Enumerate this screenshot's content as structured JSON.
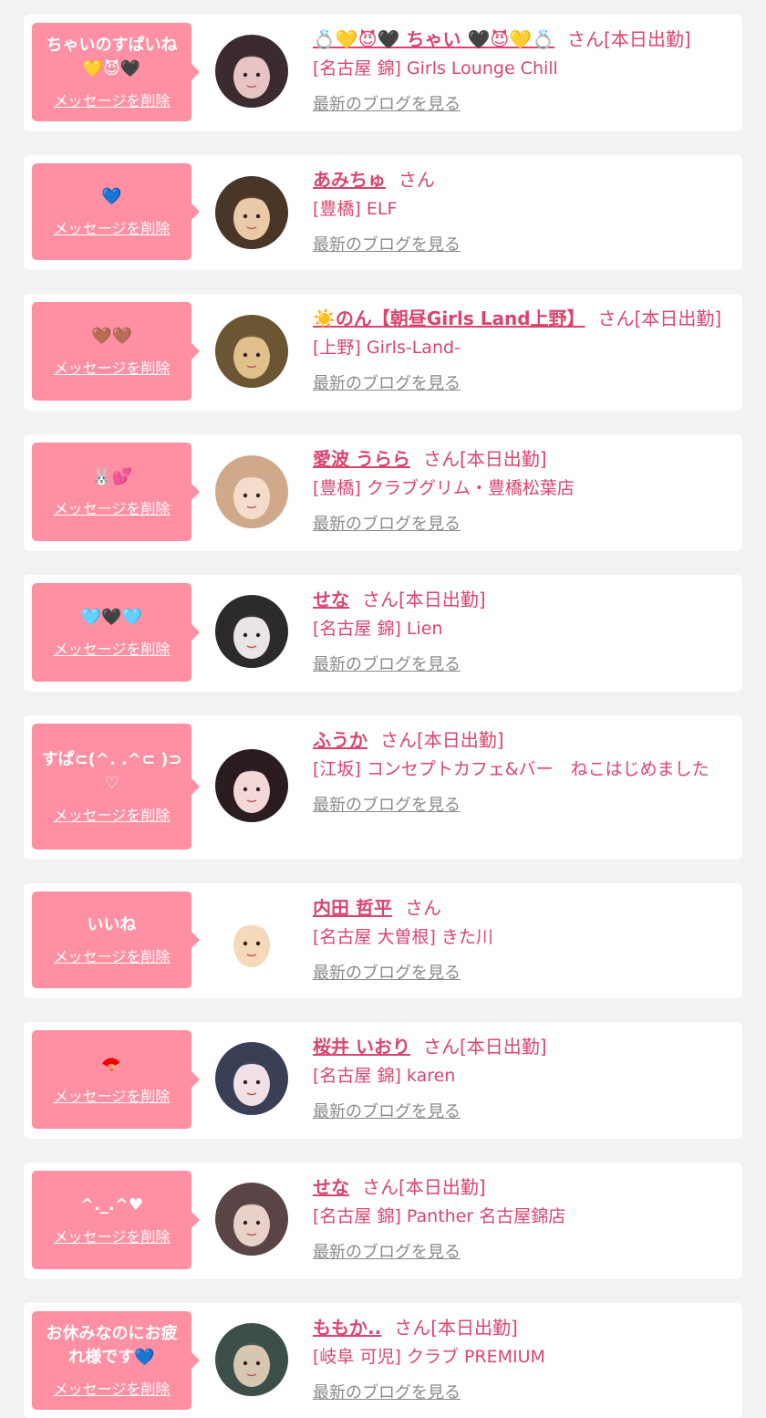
{
  "delete_label": "メッセージを削除",
  "blog_label": "最新のブログを見る",
  "san_label": "さん",
  "colors": {
    "accent": "#d9456e",
    "bubble": "#ff8fa3",
    "muted": "#8a8a8a",
    "background": "#f2f2f2"
  },
  "items": [
    {
      "message": "ちゃいのすぱいね💛😈🖤",
      "name": "💍💛😈🖤 ちゃい 🖤😈💛💍",
      "status": "[本日出勤]",
      "shop": "[名古屋 錦] Girls Lounge Chill"
    },
    {
      "message": "💙",
      "name": "あみちゅ",
      "status": "",
      "shop": "[豊橋] ELF"
    },
    {
      "message": "🤎🤎",
      "name": "☀️のん【朝昼Girls Land上野】",
      "status": "[本日出勤]",
      "shop": "[上野] Girls-Land-"
    },
    {
      "message": "🐰💕",
      "name": "愛波 うらら",
      "status": "[本日出勤]",
      "shop": "[豊橋] クラブグリム・豊橋松葉店"
    },
    {
      "message": "🩵🖤🩵",
      "name": "せな",
      "status": "[本日出勤]",
      "shop": "[名古屋 錦] Lien"
    },
    {
      "message": "すぱ⊂(^. .^⊂ )⊃♡",
      "name": "ふうか",
      "status": "[本日出勤]",
      "shop": "[江坂] コンセプトカフェ&バー　ねこはじめました"
    },
    {
      "message": "いいね",
      "name": "内田 哲平",
      "status": "",
      "shop": "[名古屋 大曽根] きた川"
    },
    {
      "message": "🪭",
      "name": "桜井 いおり",
      "status": "[本日出勤]",
      "shop": "[名古屋 錦] karen"
    },
    {
      "message": "^._.^♥",
      "name": "せな",
      "status": "[本日出勤]",
      "shop": "[名古屋 錦] Panther 名古屋錦店"
    },
    {
      "message": "お休みなのにお疲れ様です💙",
      "name": "ももか..",
      "status": "[本日出勤]",
      "shop": "[岐阜 可児] クラブ PREMIUM"
    }
  ]
}
